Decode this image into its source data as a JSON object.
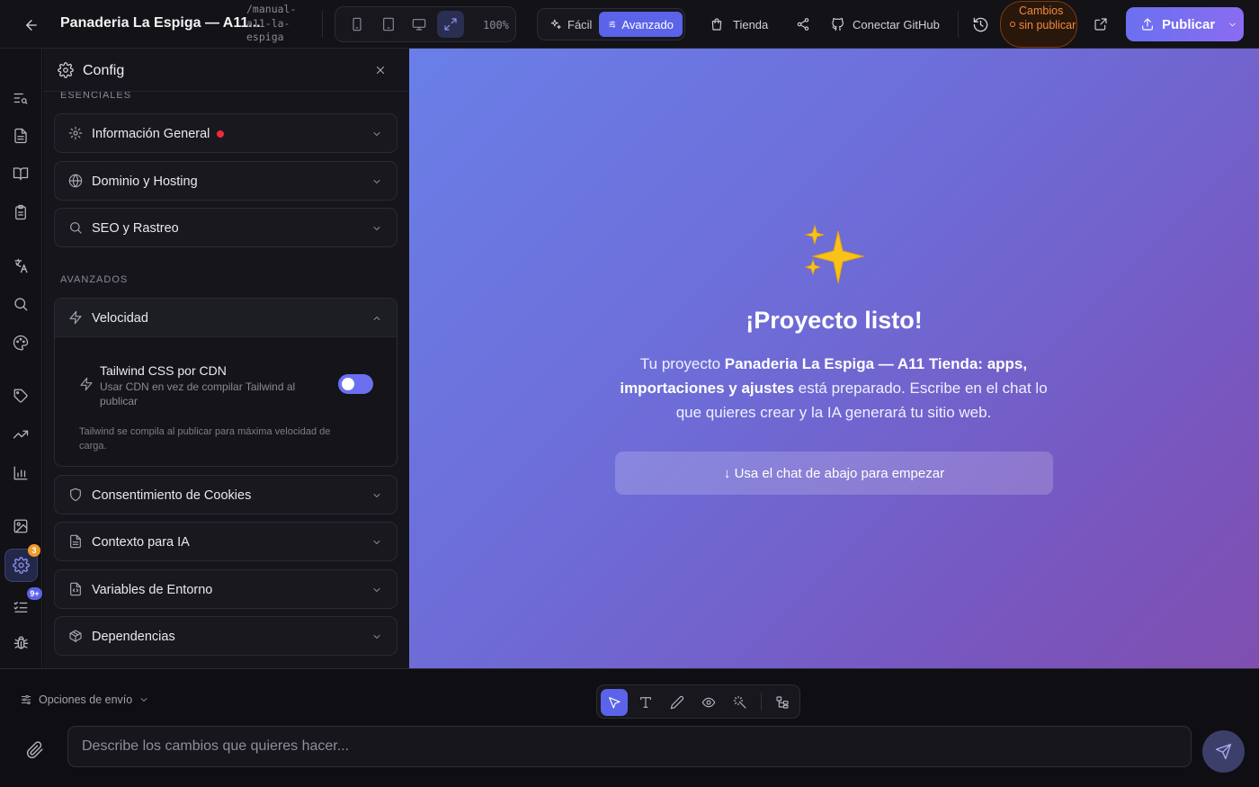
{
  "header": {
    "project_title": "Panaderia La Espiga — A11...",
    "project_slug": "/manual-a11-la-espiga",
    "zoom": "100%",
    "modes": {
      "easy": "Fácil",
      "advanced": "Avanzado"
    },
    "store_label": "Tienda",
    "github_label": "Conectar GitHub",
    "unsaved_label": "Cambios sin publicar",
    "publish_label": "Publicar"
  },
  "rail": {
    "settings_badge": "3",
    "tasks_badge": "9+"
  },
  "config": {
    "title": "Config",
    "essentials_label": "ESENCIALES",
    "advanced_label": "AVANZADOS",
    "sections": {
      "general": "Información General",
      "domain": "Dominio y Hosting",
      "seo": "SEO y Rastreo",
      "speed": "Velocidad",
      "cookies": "Consentimiento de Cookies",
      "ai_context": "Contexto para IA",
      "env_vars": "Variables de Entorno",
      "deps": "Dependencias"
    },
    "speed_option": {
      "title": "Tailwind CSS por CDN",
      "description": "Usar CDN en vez de compilar Tailwind al publicar",
      "enabled": true,
      "note": "Tailwind se compila al publicar para máxima velocidad de carga."
    }
  },
  "preview": {
    "emoji": "✨",
    "title": "¡Proyecto listo!",
    "desc_prefix": "Tu proyecto ",
    "desc_project": "Panaderia La Espiga — A11 Tienda: apps, importaciones y ajustes",
    "desc_suffix": " está preparado. Escribe en el chat lo que quieres crear y la IA generará tu sitio web.",
    "chat_hint": "↓ Usa el chat de abajo para empezar"
  },
  "chat": {
    "send_options_label": "Opciones de envío",
    "input_placeholder": "Describe los cambios que quieres hacer...",
    "input_value": ""
  },
  "colors": {
    "accent": "#5b63e8",
    "unsaved": "#f08a3a",
    "alert_dot": "#ee2b3b"
  }
}
